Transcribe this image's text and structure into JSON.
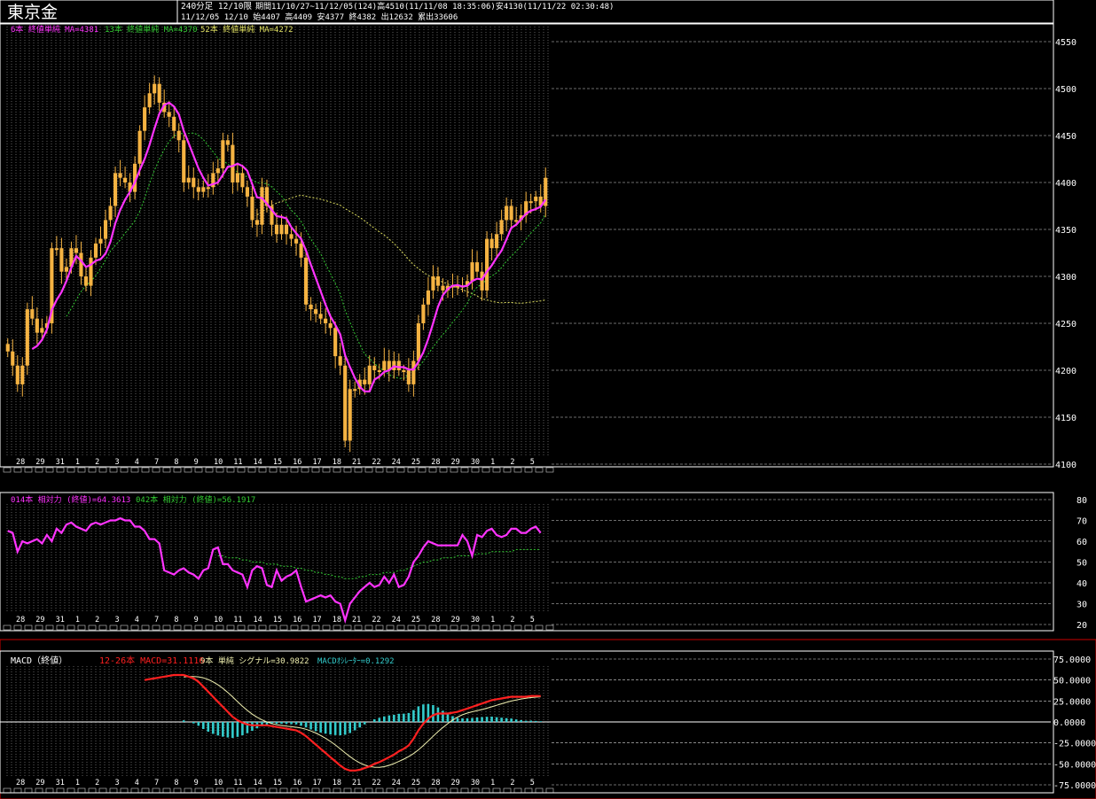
{
  "header": {
    "instrument": "東京金",
    "timeframe": "240分足 12/10限",
    "period_info": "期間11/10/27~11/12/05(124)高4510(11/11/08 18:35:06)安4130(11/11/22 02:30:48)",
    "last_bar_info": "11/12/05 12/10 始4407 高4409 安4377 終4382 出12632 累出33606"
  },
  "colors": {
    "background": "#000000",
    "grid": "#ffffff",
    "candle": "#f5b342",
    "ma_short": "#ff33ff",
    "ma_mid": "#33cc33",
    "ma_long": "#e0e060",
    "rsi_short": "#ff33ff",
    "rsi_long": "#33cc33",
    "macd_line": "#ff2020",
    "signal_line": "#f0f0b0",
    "oscillator": "#33cccc",
    "macd_panel_border": "#cc0000"
  },
  "chart_data": [
    {
      "panel": "price",
      "type": "candlestick",
      "legend": [
        "6本 終値単純 MA=4381",
        "13本 終値単純 MA=4370",
        "52本 終値単純 MA=4272"
      ],
      "yticks": [
        4550,
        4500,
        4450,
        4400,
        4350,
        4300,
        4250,
        4200,
        4150,
        4100
      ],
      "ylim": [
        4100,
        4570
      ],
      "date_labels": [
        "28",
        "29",
        "31",
        "1",
        "2",
        "3",
        "4",
        "7",
        "8",
        "9",
        "10",
        "11",
        "14",
        "15",
        "16",
        "17",
        "18",
        "21",
        "22",
        "24",
        "25",
        "28",
        "29",
        "30",
        "1",
        "2",
        "5"
      ],
      "close": [
        4220,
        4205,
        4185,
        4205,
        4265,
        4255,
        4240,
        4245,
        4250,
        4330,
        4330,
        4305,
        4310,
        4330,
        4325,
        4300,
        4290,
        4320,
        4335,
        4340,
        4360,
        4375,
        4410,
        4405,
        4400,
        4390,
        4420,
        4455,
        4480,
        4495,
        4505,
        4485,
        4475,
        4470,
        4455,
        4445,
        4400,
        4405,
        4395,
        4390,
        4395,
        4395,
        4410,
        4415,
        4445,
        4440,
        4400,
        4410,
        4395,
        4385,
        4360,
        4355,
        4395,
        4375,
        4355,
        4345,
        4355,
        4345,
        4340,
        4335,
        4320,
        4270,
        4265,
        4260,
        4255,
        4250,
        4245,
        4215,
        4205,
        4125,
        4180,
        4180,
        4190,
        4185,
        4205,
        4200,
        4200,
        4210,
        4200,
        4210,
        4200,
        4200,
        4185,
        4210,
        4250,
        4270,
        4285,
        4300,
        4290,
        4285,
        4290,
        4290,
        4290,
        4290,
        4295,
        4315,
        4305,
        4285,
        4340,
        4330,
        4345,
        4360,
        4375,
        4360,
        4360,
        4365,
        4380,
        4380,
        4385,
        4375,
        4405
      ]
    },
    {
      "panel": "rsi",
      "type": "line",
      "legend": [
        "014本 相対力 (終値)=64.3613",
        "042本 相対力 (終値)=56.1917"
      ],
      "yticks": [
        80,
        70,
        60,
        50,
        40,
        30,
        20
      ],
      "ylim": [
        20,
        80
      ],
      "series": [
        {
          "name": "014本 相対力 (終値)",
          "values": [
            65,
            64,
            55,
            60,
            59,
            60,
            61,
            59,
            63,
            60,
            66,
            64,
            68,
            69,
            67,
            66,
            65,
            68,
            69,
            68,
            69,
            70,
            70,
            71,
            70,
            70,
            67,
            67,
            65,
            61,
            61,
            59,
            46,
            45,
            44,
            46,
            47,
            45,
            44,
            42,
            46,
            47,
            56,
            57,
            49,
            49,
            46,
            45,
            44,
            38,
            46,
            48,
            47,
            39,
            38,
            46,
            41,
            43,
            44,
            46,
            38,
            31,
            32,
            33,
            34,
            33,
            34,
            31,
            30,
            22,
            30,
            33,
            36,
            38,
            40,
            38,
            39,
            43,
            40,
            44,
            38,
            39,
            43,
            50,
            53,
            57,
            60,
            59,
            58,
            58,
            58,
            58,
            58,
            63,
            60,
            53,
            63,
            62,
            65,
            66,
            63,
            62,
            63,
            66,
            66,
            64,
            64,
            66,
            67,
            64
          ]
        },
        {
          "name": "042本 相対力 (終値)",
          "values": [
            null,
            null,
            null,
            null,
            null,
            null,
            null,
            null,
            null,
            null,
            null,
            null,
            null,
            null,
            null,
            null,
            null,
            null,
            null,
            null,
            null,
            null,
            null,
            null,
            null,
            null,
            null,
            null,
            null,
            null,
            null,
            null,
            null,
            null,
            null,
            null,
            null,
            null,
            null,
            null,
            null,
            null,
            null,
            53,
            53,
            52,
            52,
            52,
            51,
            51,
            50,
            50,
            50,
            49,
            49,
            49,
            48,
            48,
            48,
            47,
            47,
            46,
            46,
            45,
            45,
            44,
            44,
            43,
            43,
            42,
            42,
            42,
            43,
            43,
            44,
            44,
            44,
            45,
            45,
            45,
            46,
            46,
            47,
            48,
            49,
            50,
            50,
            51,
            51,
            52,
            52,
            52,
            53,
            53,
            53,
            53,
            54,
            54,
            54,
            55,
            55,
            55,
            55,
            55,
            56,
            56,
            56,
            56,
            56,
            56
          ]
        }
      ]
    },
    {
      "panel": "macd",
      "type": "line+bar",
      "title": "MACD（終値）",
      "legend": [
        "12-26本 MACD=31.1116",
        "9本 単純 シグナル=30.9822",
        "MACDｵｼﾚｰﾀｰ=0.1292"
      ],
      "yticks": [
        "75.0000",
        "50.0000",
        "25.0000",
        "0.0000",
        "-25.0000",
        "-50.0000",
        "-75.0000"
      ],
      "ytick_values": [
        75,
        50,
        25,
        0,
        -25,
        -50,
        -75
      ],
      "ylim": [
        -80,
        80
      ],
      "macd": [
        null,
        null,
        null,
        null,
        null,
        null,
        null,
        null,
        null,
        null,
        null,
        null,
        null,
        null,
        null,
        null,
        null,
        null,
        null,
        null,
        null,
        null,
        null,
        null,
        null,
        null,
        null,
        null,
        50,
        51,
        52,
        53,
        54,
        55,
        56,
        56,
        56,
        54,
        52,
        48,
        42,
        36,
        30,
        24,
        18,
        12,
        6,
        2,
        -1,
        -3,
        -4,
        -4,
        -4,
        -4,
        -5,
        -6,
        -7,
        -8,
        -9,
        -10,
        -13,
        -17,
        -22,
        -27,
        -32,
        -37,
        -42,
        -47,
        -52,
        -56,
        -58,
        -58,
        -57,
        -55,
        -53,
        -50,
        -48,
        -45,
        -42,
        -39,
        -35,
        -32,
        -28,
        -20,
        -10,
        -2,
        4,
        8,
        10,
        10,
        10,
        11,
        12,
        14,
        16,
        18,
        20,
        22,
        24,
        26,
        27,
        28,
        29,
        30,
        30,
        30,
        30,
        31,
        31,
        31
      ]
    }
  ]
}
